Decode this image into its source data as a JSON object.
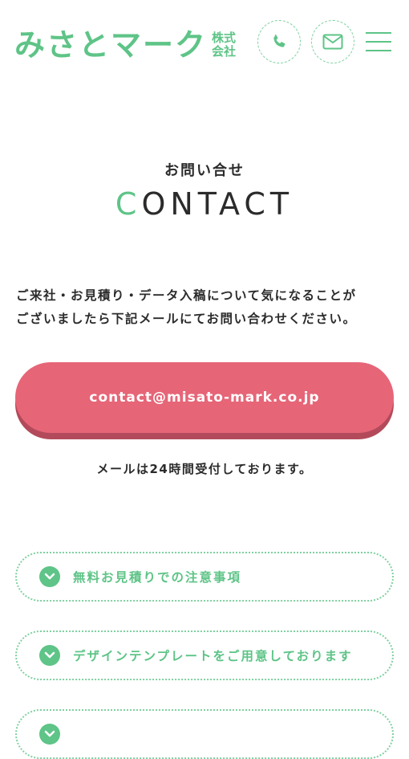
{
  "header": {
    "logo_main": "みさとマーク",
    "logo_sub_line1": "株式",
    "logo_sub_line2": "会社",
    "phone_icon": "phone-icon",
    "mail_icon": "mail-icon",
    "menu_icon": "hamburger-menu-icon",
    "brand_color": "#5ec487"
  },
  "contact": {
    "subtitle": "お問い合せ",
    "title_first": "C",
    "title_rest": "ONTACT",
    "intro_line1": "ご来社・お見積り・データ入稿について気になることが",
    "intro_line2": "ございましたら下記メールにてお問い合わせください。",
    "email": "contact@misato-mark.co.jp",
    "email_button_color": "#e66577",
    "reception": "メールは24時間受付しております。"
  },
  "faq": {
    "items": [
      {
        "label": "無料お見積りでの注意事項"
      },
      {
        "label": "デザインテンプレートをご用意しております"
      },
      {
        "label": ""
      }
    ]
  }
}
